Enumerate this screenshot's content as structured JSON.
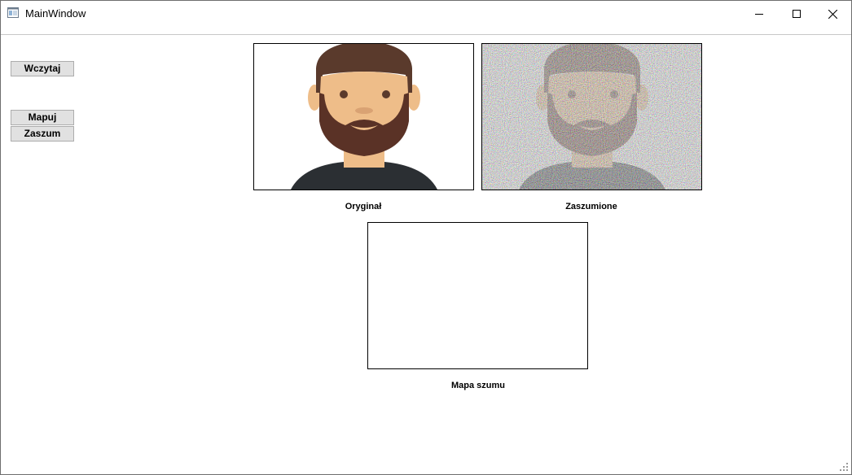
{
  "window": {
    "title": "MainWindow",
    "icon": "app-window-icon",
    "controls": [
      "minimize-icon",
      "maximize-icon",
      "close-icon"
    ]
  },
  "buttons": {
    "load_label": "Wczytaj",
    "map_label": "Mapuj",
    "noise_label": "Zaszum"
  },
  "images": {
    "original_caption": "Oryginał",
    "noisy_caption": "Zaszumione",
    "noise_map_caption": "Mapa szumu"
  },
  "colors": {
    "skin": "#eebd89",
    "hair": "#5a3a2c",
    "beard": "#5a3226",
    "shirt": "#2b2f33",
    "button_bg": "#e1e1e1"
  }
}
